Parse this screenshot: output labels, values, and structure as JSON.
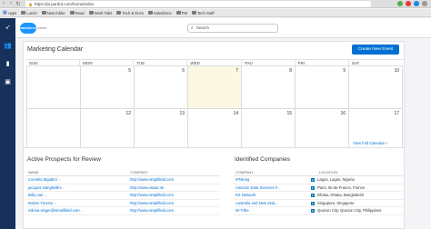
{
  "browser": {
    "url": "https://pi.pardot.com/home/index",
    "bookmarks": [
      "Apps",
      "Lunch",
      "New folder",
      "Read",
      "Work Tabs",
      "Tech & Docs",
      "Salesforce",
      "PM",
      "Tech Stuff"
    ]
  },
  "header": {
    "logo": "salesforce",
    "logo_sub": "pardot",
    "search_placeholder": "Search"
  },
  "calendar": {
    "title": "Marketing Calendar",
    "create_label": "Create New Event",
    "days": [
      "SUN",
      "MON",
      "TUE",
      "WED",
      "THU",
      "FRI",
      "SAT"
    ],
    "week1": [
      "",
      "5",
      "6",
      "7",
      "8",
      "9",
      "10"
    ],
    "week2": [
      "",
      "12",
      "13",
      "14",
      "15",
      "16",
      "17"
    ],
    "today_index": 3,
    "view_full": "View Full Calendar »"
  },
  "prospects": {
    "title": "Active Prospects for Review",
    "columns": [
      "NAME",
      "COMPANY"
    ],
    "rows": [
      {
        "name": "Cornelia Mgadmi",
        "company": "http://www.simplifield.com"
      },
      {
        "name": "jacques stanghellini",
        "company": "http://www.visaur.nk"
      },
      {
        "name": "kelly van",
        "company": "http://www.simplifield.com"
      },
      {
        "name": "Ruben Trevino",
        "company": "http://www.simplifield.com"
      },
      {
        "name": "milena singer@simplifield.com",
        "company": "http://www.simplifield.com"
      }
    ]
  },
  "companies": {
    "title": "Identified Companies",
    "columns": [
      "COMPANY",
      "LOCATION"
    ],
    "rows": [
      {
        "company": "IPNKing",
        "location": "Lagos, Lagos, Nigeria"
      },
      {
        "company": "Amazon Data Services F...",
        "location": "Paris, Ile-de-France, France"
      },
      {
        "company": "KS Network",
        "location": "Dhaka, Dhaka, Bangladesh"
      },
      {
        "company": "Australia and New Zeal...",
        "location": "Singapore, Singapore"
      },
      {
        "company": "W-Tribe",
        "location": "Quezon City, Quezon City, Philippines"
      }
    ]
  }
}
